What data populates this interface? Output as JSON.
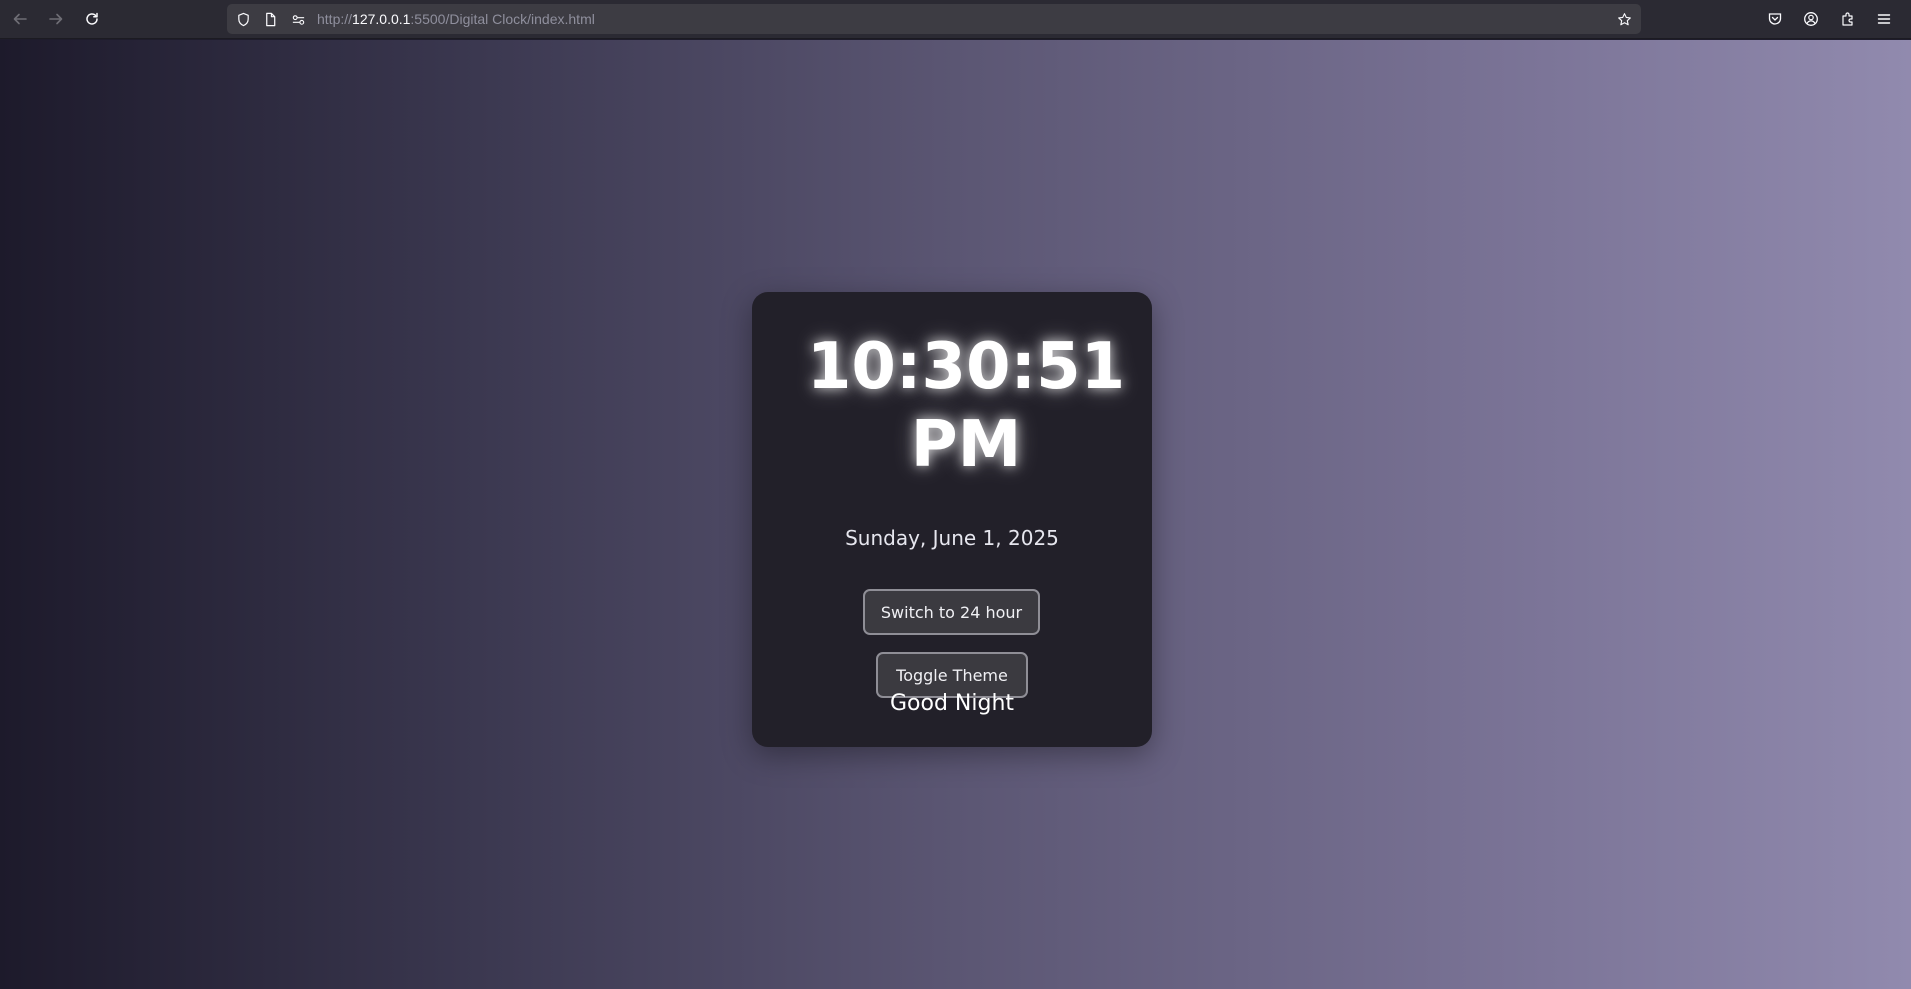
{
  "browser": {
    "url_prefix": "http://",
    "url_host": "127.0.0.1",
    "url_path": ":5500/Digital Clock/index.html"
  },
  "clock": {
    "time": "10:30:51 PM",
    "date": "Sunday, June 1, 2025",
    "format_button_label": "Switch to 24 hour",
    "theme_button_label": "Toggle Theme",
    "greeting": "Good Night"
  },
  "colors": {
    "card_background": "#222029",
    "gradient_start": "#1d1a2b",
    "gradient_end": "#918aae",
    "button_background": "#3b3a40"
  }
}
